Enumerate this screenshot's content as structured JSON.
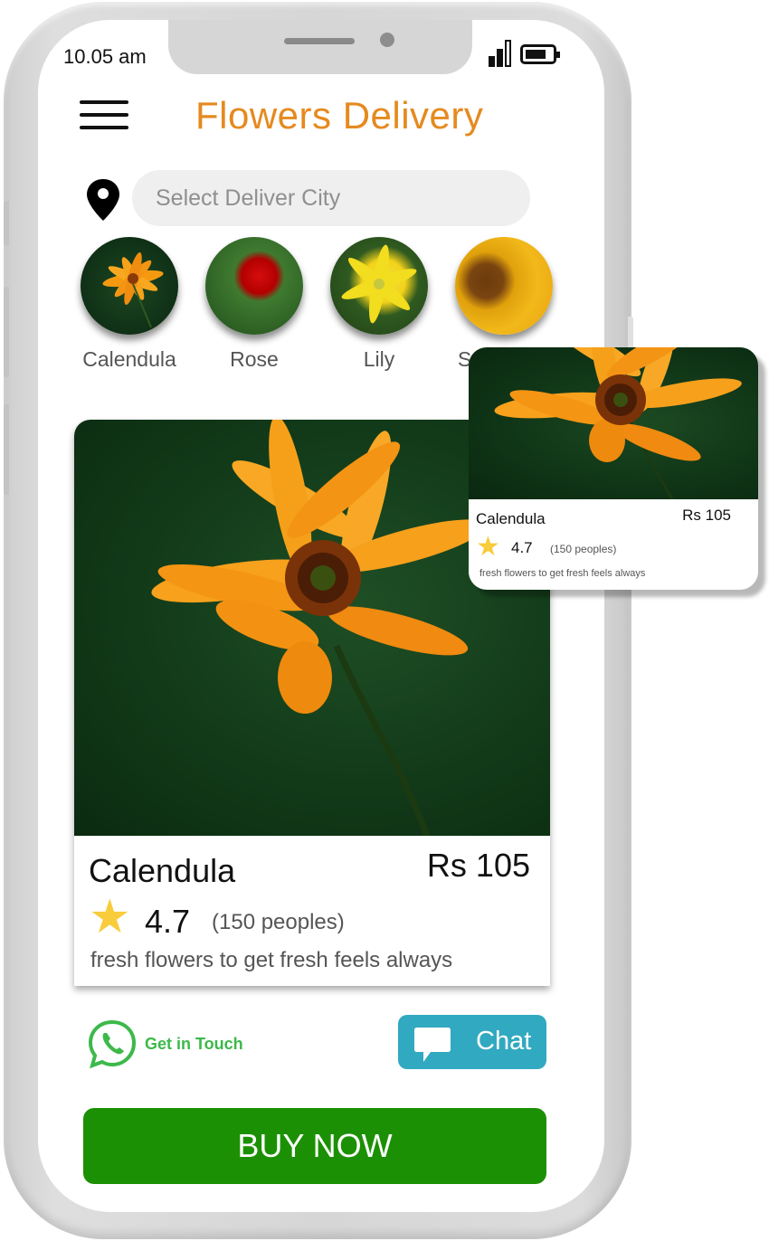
{
  "status_bar": {
    "time": "10.05 am",
    "icons": [
      "signal-icon",
      "battery-icon"
    ]
  },
  "header": {
    "menu_icon": "hamburger-menu-icon",
    "title": "Flowers Delivery"
  },
  "location": {
    "icon": "location-pin-icon",
    "placeholder": "Select Deliver City",
    "value": ""
  },
  "categories": [
    {
      "label": "Calendula",
      "icon": "calendula-image"
    },
    {
      "label": "Rose",
      "icon": "rose-image"
    },
    {
      "label": "Lily",
      "icon": "lily-image"
    },
    {
      "label": "Sunflower",
      "icon": "sunflower-image"
    }
  ],
  "product_card": {
    "name": "Calendula",
    "price": "Rs 105",
    "rating": "4.7",
    "rating_count": "(150 peoples)",
    "description": "fresh flowers to get fresh feels always"
  },
  "popup_card": {
    "name": "Calendula",
    "price": "Rs 105",
    "rating": "4.7",
    "rating_count": "(150 peoples)",
    "description": "fresh flowers to get fresh feels always"
  },
  "actions": {
    "whatsapp_label": "Get in Touch",
    "chat_label": "Chat",
    "buy_label": "BUY NOW"
  },
  "colors": {
    "title": "#e58a1f",
    "buy_button": "#1c9004",
    "chat_button": "#31a9c0",
    "whatsapp": "#3cb94a",
    "star": "#f8cc3a"
  }
}
